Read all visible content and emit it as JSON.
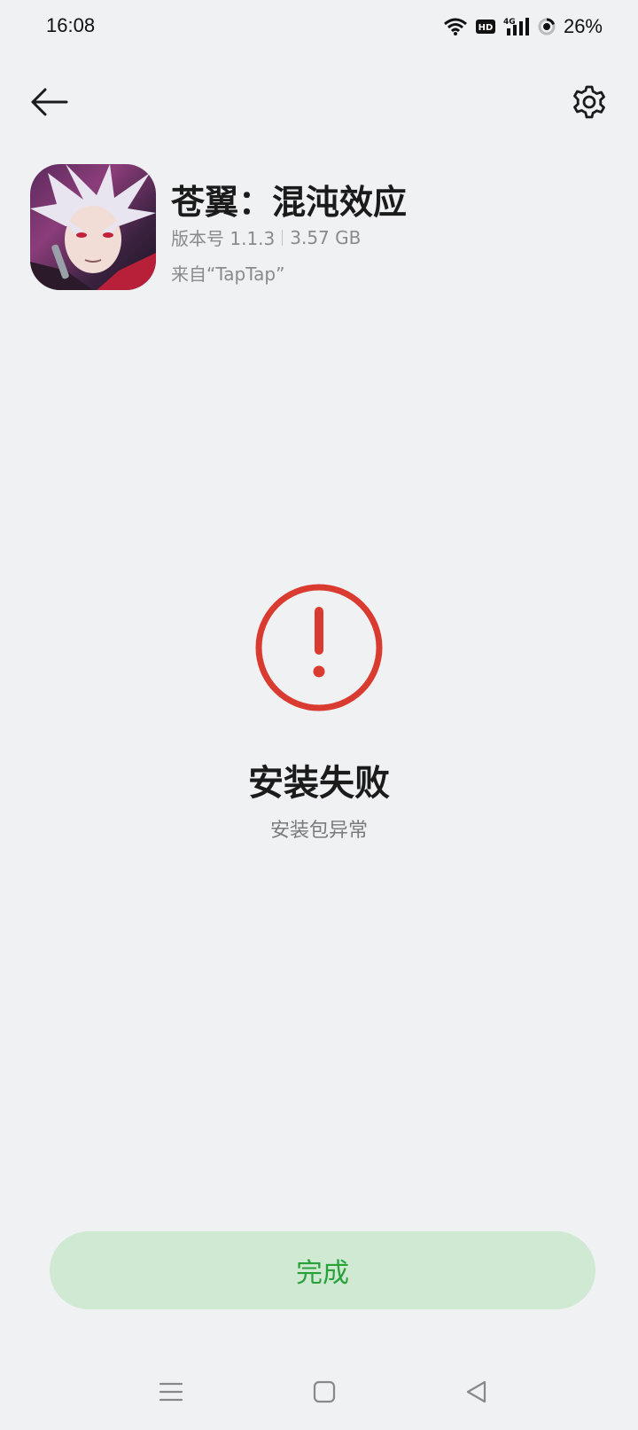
{
  "status_bar": {
    "time": "16:08",
    "battery_percent": "26%",
    "icons": [
      "wifi-icon",
      "hd-icon",
      "signal-4g-icon",
      "battery-ring-icon"
    ]
  },
  "top_bar": {
    "back_icon": "arrow-left-icon",
    "settings_icon": "gear-icon"
  },
  "app": {
    "name": "苍翼：混沌效应",
    "version": "版本号 1.1.3",
    "size": "3.57 GB",
    "source": "来自“TapTap”"
  },
  "result": {
    "icon": "alert-circle-icon",
    "title": "安装失败",
    "subtitle": "安装包异常",
    "accent_color": "#d93b30"
  },
  "actions": {
    "done_label": "完成",
    "done_bg": "#cfe9d3",
    "done_color": "#27a23a"
  },
  "nav_bar": {
    "icons": [
      "menu-icon",
      "home-icon",
      "back-triangle-icon"
    ]
  }
}
